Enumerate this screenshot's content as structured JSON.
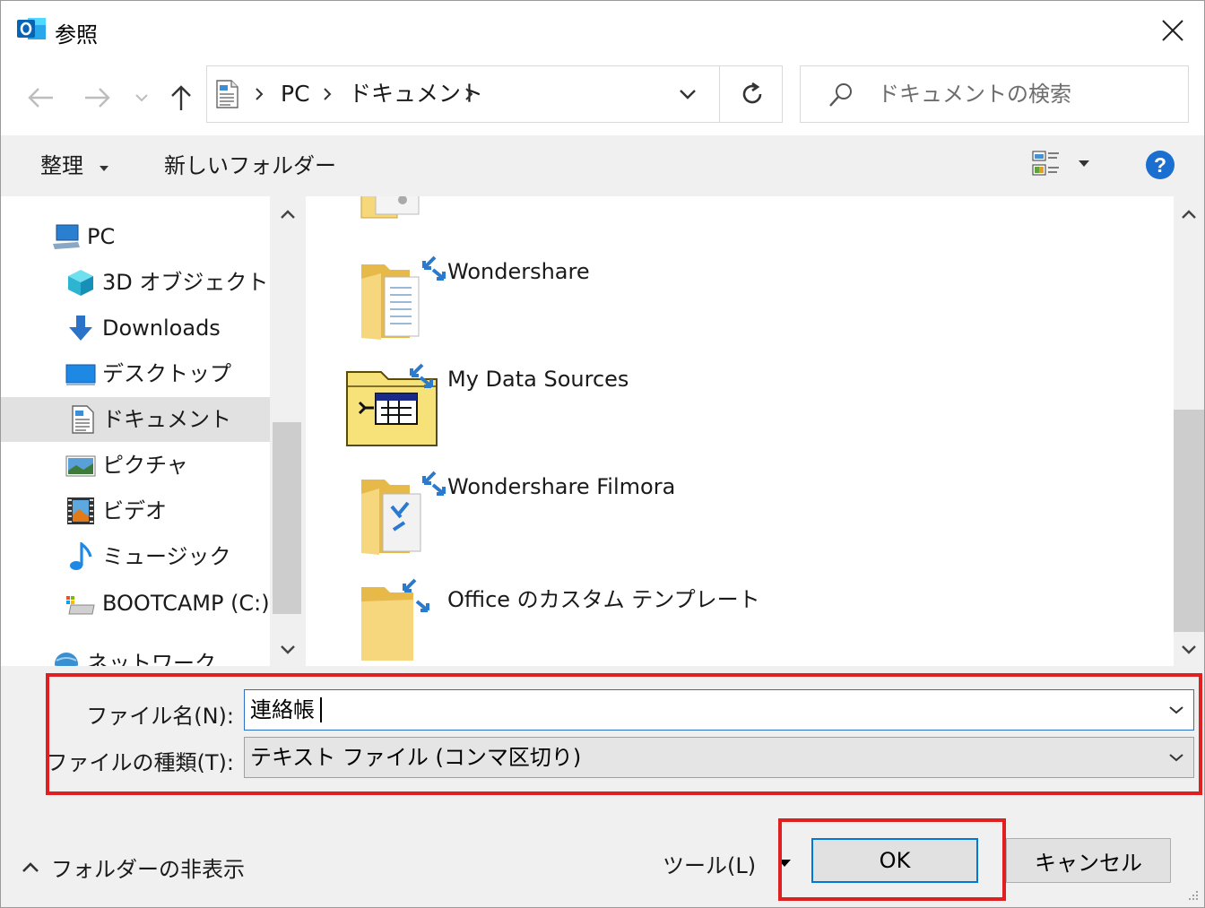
{
  "window": {
    "title": "参照",
    "app_icon": "outlook-icon"
  },
  "address": {
    "segments": [
      "PC",
      "ドキュメント"
    ]
  },
  "search": {
    "placeholder": "ドキュメントの検索"
  },
  "toolbar": {
    "organize_label": "整理",
    "new_folder_label": "新しいフォルダー"
  },
  "sidebar": {
    "items": [
      {
        "label": "PC",
        "icon": "pc-icon"
      },
      {
        "label": "3D オブジェクト",
        "icon": "3d-objects-icon"
      },
      {
        "label": "Downloads",
        "icon": "downloads-icon"
      },
      {
        "label": "デスクトップ",
        "icon": "desktop-icon"
      },
      {
        "label": "ドキュメント",
        "icon": "documents-icon",
        "selected": true
      },
      {
        "label": "ピクチャ",
        "icon": "pictures-icon"
      },
      {
        "label": "ビデオ",
        "icon": "videos-icon"
      },
      {
        "label": "ミュージック",
        "icon": "music-icon"
      },
      {
        "label": "BOOTCAMP (C:)",
        "icon": "drive-icon"
      },
      {
        "label": "ネットワーク",
        "icon": "network-icon"
      }
    ]
  },
  "files": {
    "items": [
      {
        "label": "Wondershare",
        "icon": "folder-icon"
      },
      {
        "label": "My Data Sources",
        "icon": "data-sources-folder-icon"
      },
      {
        "label": "Wondershare Filmora",
        "icon": "folder-icon"
      },
      {
        "label": "Office のカスタム テンプレート",
        "icon": "folder-icon"
      }
    ]
  },
  "form": {
    "filename_label": "ファイル名(N):",
    "filename_value": "連絡帳",
    "filetype_label": "ファイルの種類(T):",
    "filetype_value": "テキスト ファイル (コンマ区切り)"
  },
  "footer": {
    "hide_folders_label": "フォルダーの非表示",
    "tools_label": "ツール(L)",
    "ok_label": "OK",
    "cancel_label": "キャンセル"
  },
  "colors": {
    "highlight": "#e02020",
    "accent": "#0078d7",
    "help": "#1a6fd1"
  }
}
